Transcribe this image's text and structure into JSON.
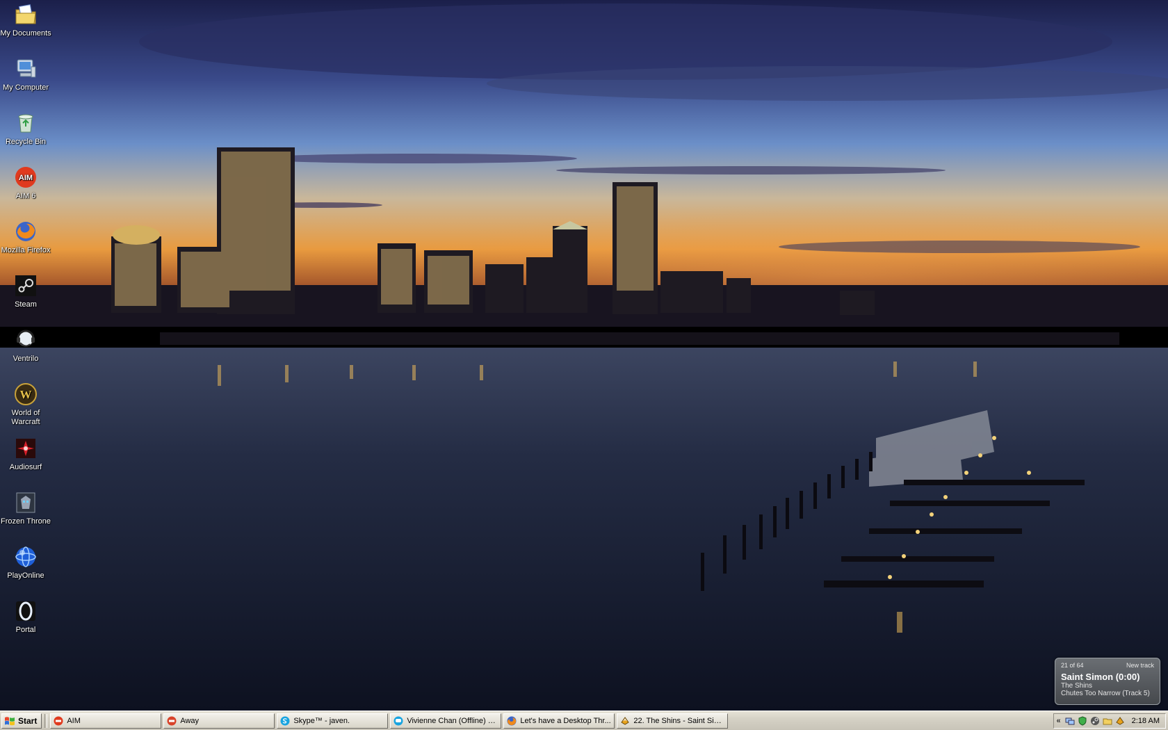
{
  "desktop": {
    "icons": [
      {
        "label": "My Documents",
        "icon": "my-documents-icon"
      },
      {
        "label": "My Computer",
        "icon": "my-computer-icon"
      },
      {
        "label": "Recycle Bin",
        "icon": "recycle-bin-icon"
      },
      {
        "label": "AIM 6",
        "icon": "aim-icon",
        "glyph": "AIM"
      },
      {
        "label": "Mozilla Firefox",
        "icon": "firefox-icon"
      },
      {
        "label": "Steam",
        "icon": "steam-icon"
      },
      {
        "label": "Ventrilo",
        "icon": "ventrilo-icon"
      },
      {
        "label": "World of Warcraft",
        "icon": "world-of-warcraft-icon",
        "glyph": "W"
      },
      {
        "label": "Audiosurf",
        "icon": "audiosurf-icon"
      },
      {
        "label": "Frozen Throne",
        "icon": "frozen-throne-icon"
      },
      {
        "label": "PlayOnline",
        "icon": "playonline-icon"
      },
      {
        "label": "Portal",
        "icon": "portal-icon"
      }
    ]
  },
  "now_playing": {
    "position": "21 of 64",
    "status": "New track",
    "title": "Saint Simon (0:00)",
    "artist": "The Shins",
    "album": "Chutes Too Narrow (Track 5)"
  },
  "taskbar": {
    "start_label": "Start",
    "tasks": [
      {
        "label": "AIM",
        "icon": "aim-icon"
      },
      {
        "label": "Away",
        "icon": "aim-away-icon"
      },
      {
        "label": "Skype™ - javen.",
        "icon": "skype-icon"
      },
      {
        "label": "Vivienne Chan (Offline) S...",
        "icon": "chat-icon"
      },
      {
        "label": "Let's have a Desktop Thr...",
        "icon": "firefox-icon"
      },
      {
        "label": "22. The Shins - Saint Sim...",
        "icon": "winamp-icon"
      }
    ],
    "tray": {
      "expand": "«",
      "icons": [
        "network-icon",
        "security-shield-icon",
        "steam-tray-icon",
        "folder-tray-icon",
        "winamp-tray-icon"
      ],
      "clock": "2:18 AM"
    }
  },
  "colors": {
    "taskbar": "#d4d0c4",
    "sky_top": "#1d2350",
    "sky_horizon": "#e8943a",
    "water": "#141a2c"
  }
}
